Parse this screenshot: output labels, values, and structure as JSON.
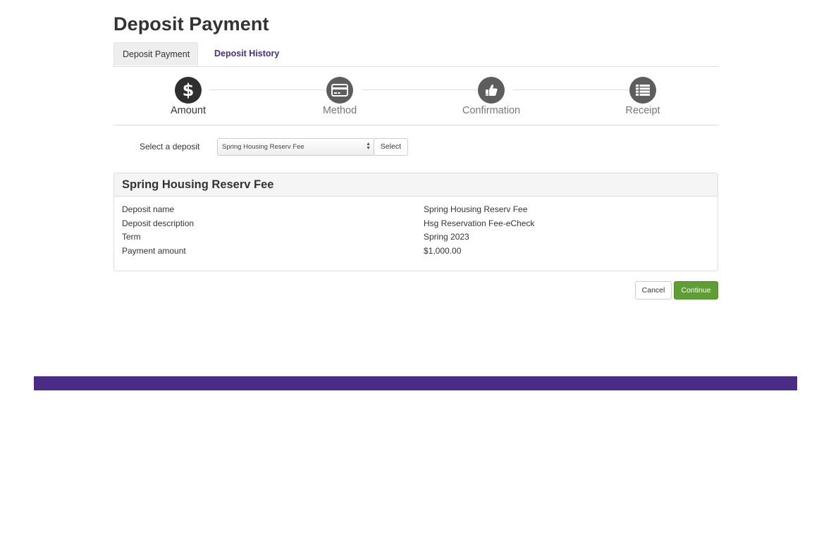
{
  "page": {
    "title": "Deposit Payment"
  },
  "tabs": [
    {
      "label": "Deposit Payment",
      "active": true
    },
    {
      "label": "Deposit History",
      "active": false
    }
  ],
  "steps": [
    {
      "label": "Amount",
      "icon": "dollar-icon",
      "active": true
    },
    {
      "label": "Method",
      "icon": "credit-card-icon",
      "active": false
    },
    {
      "label": "Confirmation",
      "icon": "thumbs-up-icon",
      "active": false
    },
    {
      "label": "Receipt",
      "icon": "list-icon",
      "active": false
    }
  ],
  "deposit_select": {
    "label": "Select a deposit",
    "selected": "Spring Housing Reserv Fee",
    "button_label": "Select"
  },
  "deposit_panel": {
    "title": "Spring Housing Reserv Fee",
    "rows": [
      {
        "label": "Deposit name",
        "value": "Spring Housing Reserv Fee"
      },
      {
        "label": "Deposit description",
        "value": "Hsg Reservation Fee-eCheck"
      },
      {
        "label": "Term",
        "value": "Spring 2023"
      },
      {
        "label": "Payment amount",
        "value": "$1,000.00"
      }
    ]
  },
  "actions": {
    "cancel_label": "Cancel",
    "continue_label": "Continue"
  },
  "colors": {
    "brand_purple": "#4b2c84",
    "continue_green": "#5f9e34",
    "step_active": "#2f2f2f",
    "step_inactive": "#5d5d5d"
  }
}
